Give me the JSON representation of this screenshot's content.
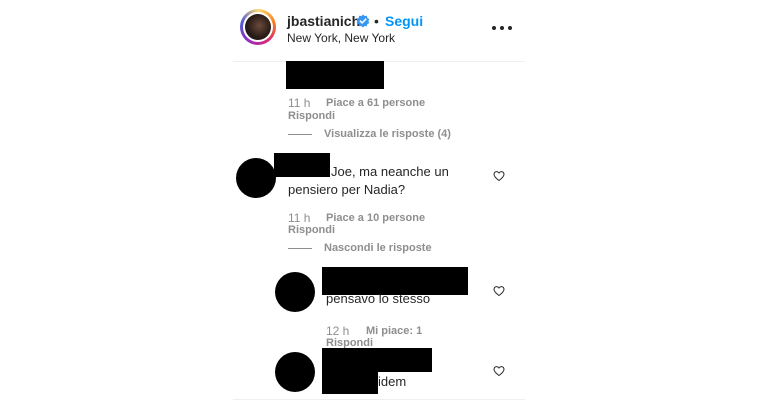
{
  "header": {
    "username": "jbastianich",
    "dot": "•",
    "follow_label": "Segui",
    "location": "New York, New York"
  },
  "comments": [
    {
      "time": "11 h",
      "likes": "Piace a 61 persone",
      "reply": "Rispondi",
      "toggle": "Visualizza le risposte (4)"
    },
    {
      "text_line1": "Joe, ma neanche un",
      "text_line2": "pensiero per Nadia?",
      "time": "11 h",
      "likes": "Piace a 10 persone",
      "reply": "Rispondi",
      "toggle": "Nascondi le risposte"
    }
  ],
  "replies": [
    {
      "text": "pensavo lo stesso",
      "time": "12 h",
      "likes": "Mi piace: 1",
      "reply": "Rispondi"
    },
    {
      "text": "idem"
    }
  ],
  "icons": {
    "verified": "verified-badge-icon",
    "more": "more-options-icon",
    "heart": "heart-outline-icon"
  },
  "colors": {
    "link_blue": "#0095f6",
    "text": "#262626",
    "muted": "#8e8e8e"
  }
}
